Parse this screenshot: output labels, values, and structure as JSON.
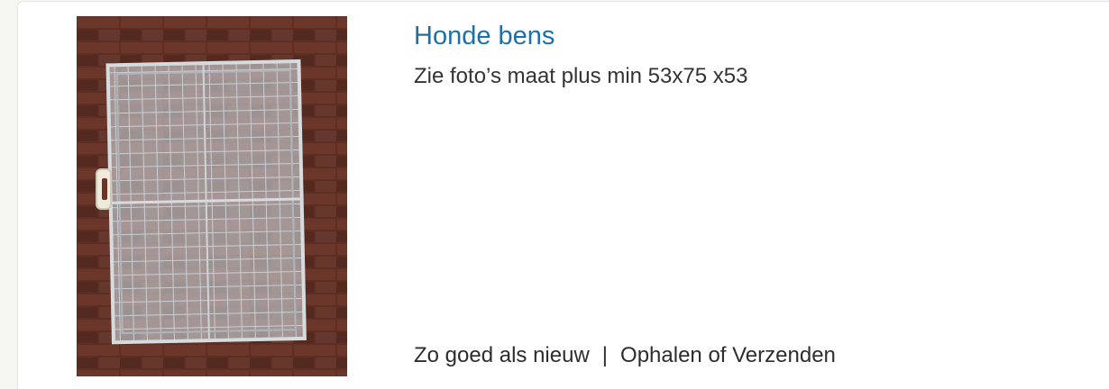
{
  "listing": {
    "title": "Honde bens",
    "description": "Zie foto’s maat plus min 53x75 x53",
    "condition": "Zo goed als nieuw",
    "separator": "|",
    "delivery": "Ophalen of Verzenden",
    "image_subject": "wire-dog-crate-photo",
    "colors": {
      "title": "#1f6fa7",
      "text": "#333333",
      "background": "#f5f5f2",
      "card": "#ffffff"
    }
  }
}
